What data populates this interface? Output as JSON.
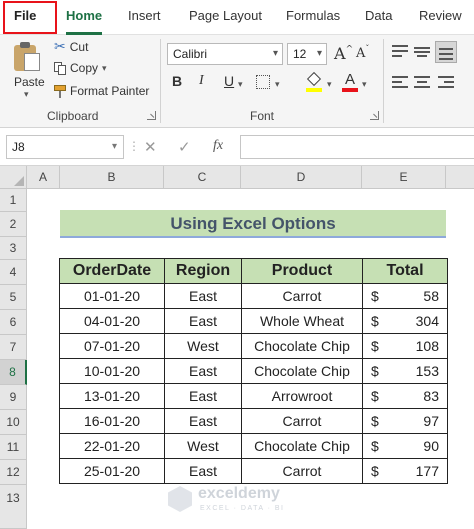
{
  "tabs": [
    "File",
    "Home",
    "Insert",
    "Page Layout",
    "Formulas",
    "Data",
    "Review"
  ],
  "ribbon": {
    "clipboard": {
      "paste_label": "Paste",
      "cut_label": "Cut",
      "copy_label": "Copy",
      "format_painter_label": "Format Painter",
      "group_label": "Clipboard"
    },
    "font": {
      "font_name": "Calibri",
      "font_size": "12",
      "bold": "B",
      "italic": "I",
      "underline": "U",
      "grow": "A",
      "shrink": "A",
      "font_color_glyph": "A",
      "group_label": "Font",
      "fill_color": "#ffff00",
      "font_color": "#e8131a"
    }
  },
  "formula_bar": {
    "name_box": "J8",
    "cancel": "✕",
    "enter": "✓",
    "fx": "fx",
    "value": ""
  },
  "grid": {
    "columns": [
      "A",
      "B",
      "C",
      "D",
      "E"
    ],
    "rows": [
      "1",
      "2",
      "3",
      "4",
      "5",
      "6",
      "7",
      "8",
      "9",
      "10",
      "11",
      "12",
      "13"
    ],
    "selected_row": "8",
    "title": "Using Excel Options",
    "headers": [
      "OrderDate",
      "Region",
      "Product",
      "Total"
    ],
    "currency": "$",
    "records": [
      {
        "date": "01-01-20",
        "region": "East",
        "product": "Carrot",
        "total": "58"
      },
      {
        "date": "04-01-20",
        "region": "East",
        "product": "Whole Wheat",
        "total": "304"
      },
      {
        "date": "07-01-20",
        "region": "West",
        "product": "Chocolate Chip",
        "total": "108"
      },
      {
        "date": "10-01-20",
        "region": "East",
        "product": "Chocolate Chip",
        "total": "153"
      },
      {
        "date": "13-01-20",
        "region": "East",
        "product": "Arrowroot",
        "total": "83"
      },
      {
        "date": "16-01-20",
        "region": "East",
        "product": "Carrot",
        "total": "97"
      },
      {
        "date": "22-01-20",
        "region": "West",
        "product": "Chocolate Chip",
        "total": "90"
      },
      {
        "date": "25-01-20",
        "region": "East",
        "product": "Carrot",
        "total": "177"
      }
    ]
  },
  "watermark": {
    "name": "exceldemy",
    "tagline": "EXCEL · DATA · BI"
  },
  "colors": {
    "accent": "#1e7145",
    "highlight_box": "#e8131a",
    "header_fill": "#c6e0b4"
  }
}
